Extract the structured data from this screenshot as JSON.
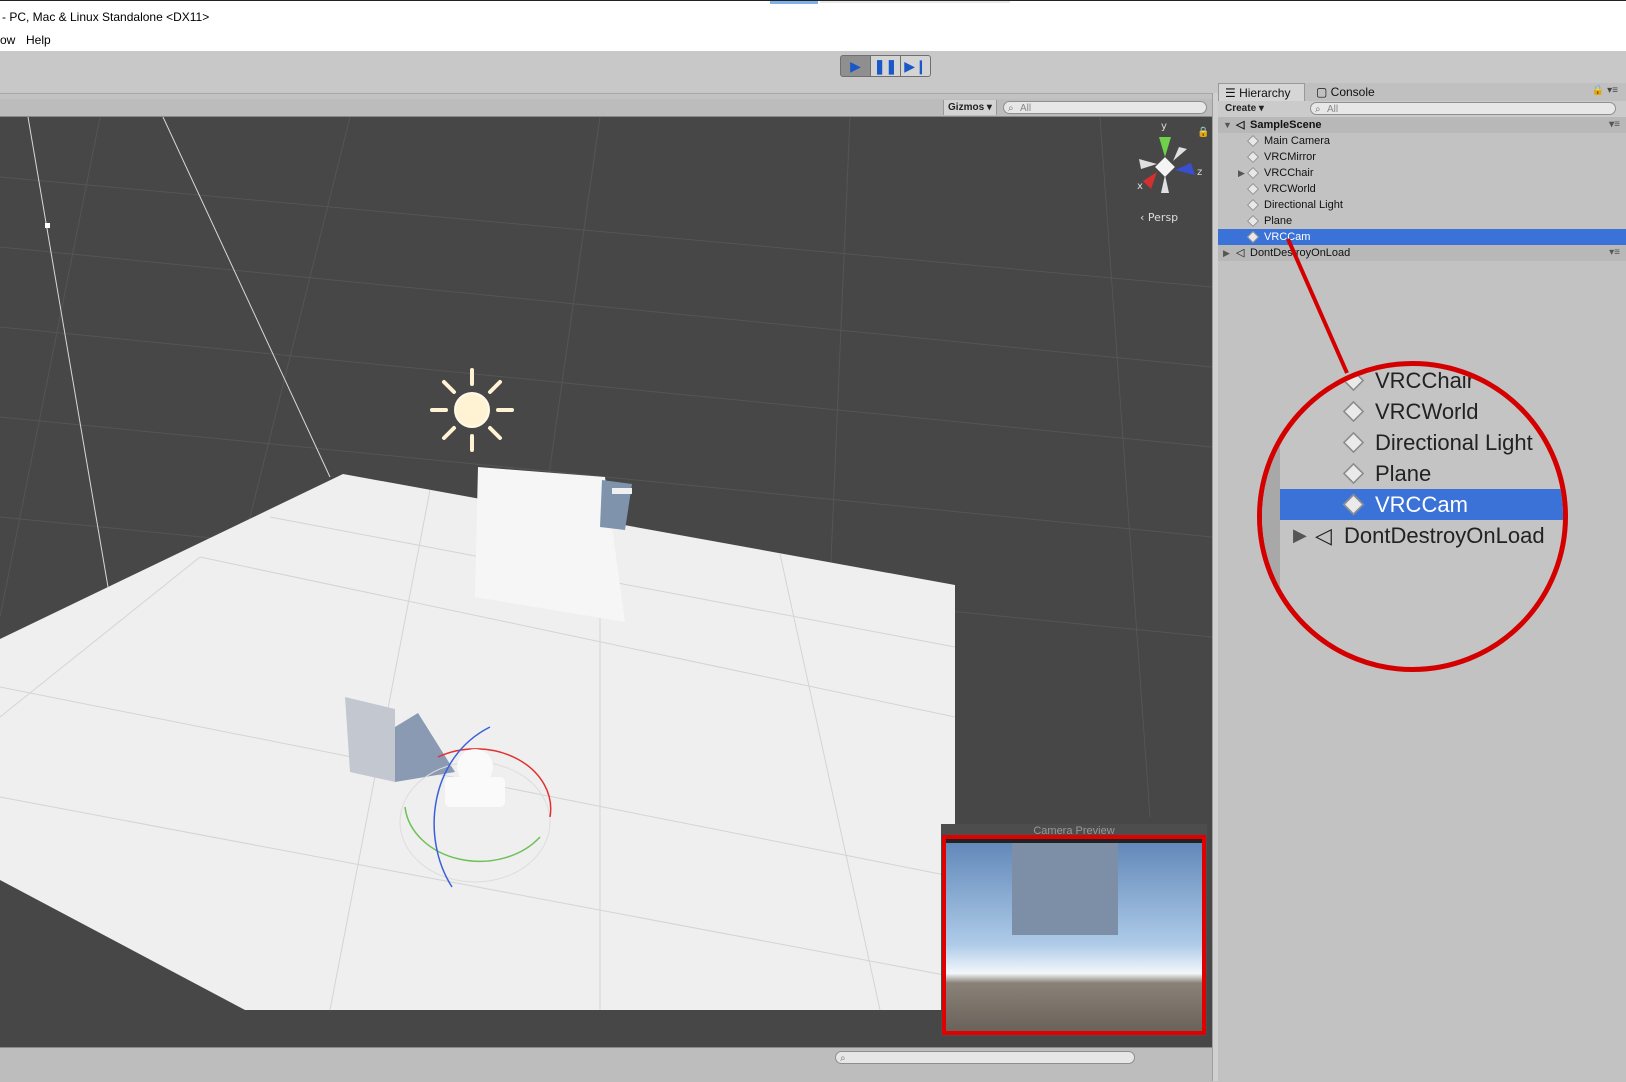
{
  "window": {
    "title": "- PC, Mac & Linux Standalone <DX11>"
  },
  "menu": {
    "items": [
      "ow",
      "Help"
    ]
  },
  "playbar": {
    "play": "▶",
    "pause": "❚❚",
    "step": "▶❙"
  },
  "scene_header": {
    "gizmos": "Gizmos",
    "search_placeholder": "All"
  },
  "scene": {
    "persp_label": "Persp",
    "axis_x": "x",
    "axis_y": "y",
    "axis_z": "z"
  },
  "camera_preview": {
    "title": "Camera Preview"
  },
  "hierarchy": {
    "tabs": [
      "Hierarchy",
      "Console"
    ],
    "create_label": "Create",
    "search_placeholder": "All",
    "scene_name": "SampleScene",
    "items": [
      {
        "label": "Main Camera"
      },
      {
        "label": "VRCMirror"
      },
      {
        "label": "VRCChair",
        "expandable": true
      },
      {
        "label": "VRCWorld"
      },
      {
        "label": "Directional Light"
      },
      {
        "label": "Plane"
      },
      {
        "label": "VRCCam",
        "selected": true
      }
    ],
    "dontdestroy": "DontDestroyOnLoad"
  },
  "callout": {
    "items": [
      "VRCChair",
      "VRCWorld",
      "Directional Light",
      "Plane",
      "VRCCam"
    ],
    "selected": "VRCCam",
    "dontdestroy": "DontDestroyOnLoad"
  },
  "colors": {
    "selection": "#3a72d8",
    "highlight": "#d40000",
    "scene_bg": "#474747"
  }
}
